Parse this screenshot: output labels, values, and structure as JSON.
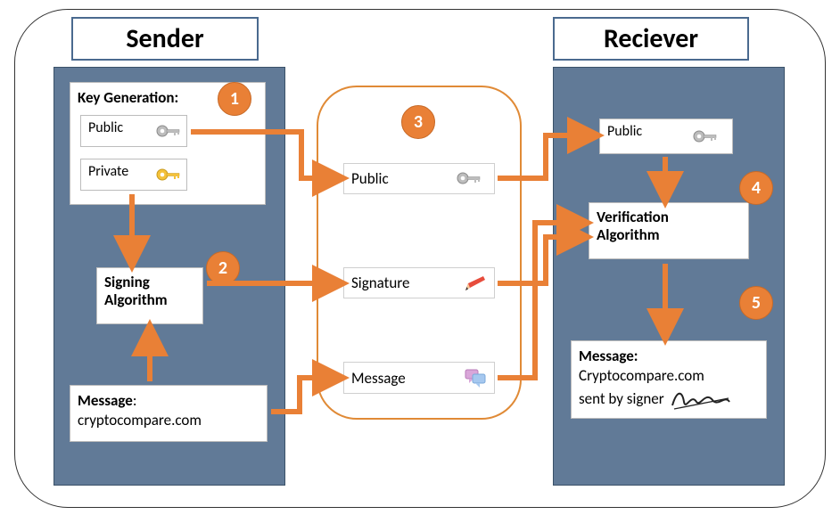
{
  "titles": {
    "sender": "Sender",
    "receiver": "Reciever"
  },
  "sender": {
    "keygen_label": "Key Generation:",
    "public_label": "Public",
    "private_label": "Private",
    "signing_label_l1": "Signing",
    "signing_label_l2": "Algorithm",
    "message_label": "Message",
    "message_value": "cryptocompare.com"
  },
  "middle": {
    "public": "Public",
    "signature": "Signature",
    "message": "Message"
  },
  "receiver": {
    "public": "Public",
    "verify_l1": "Verification",
    "verify_l2": "Algorithm",
    "msg_label": "Message:",
    "msg_l1": "Cryptocompare.com",
    "msg_l2": "sent by signer"
  },
  "badges": {
    "b1": "1",
    "b2": "2",
    "b3": "3",
    "b4": "4",
    "b5": "5"
  },
  "colors": {
    "panel": "#617a97",
    "accent": "#e98036"
  }
}
